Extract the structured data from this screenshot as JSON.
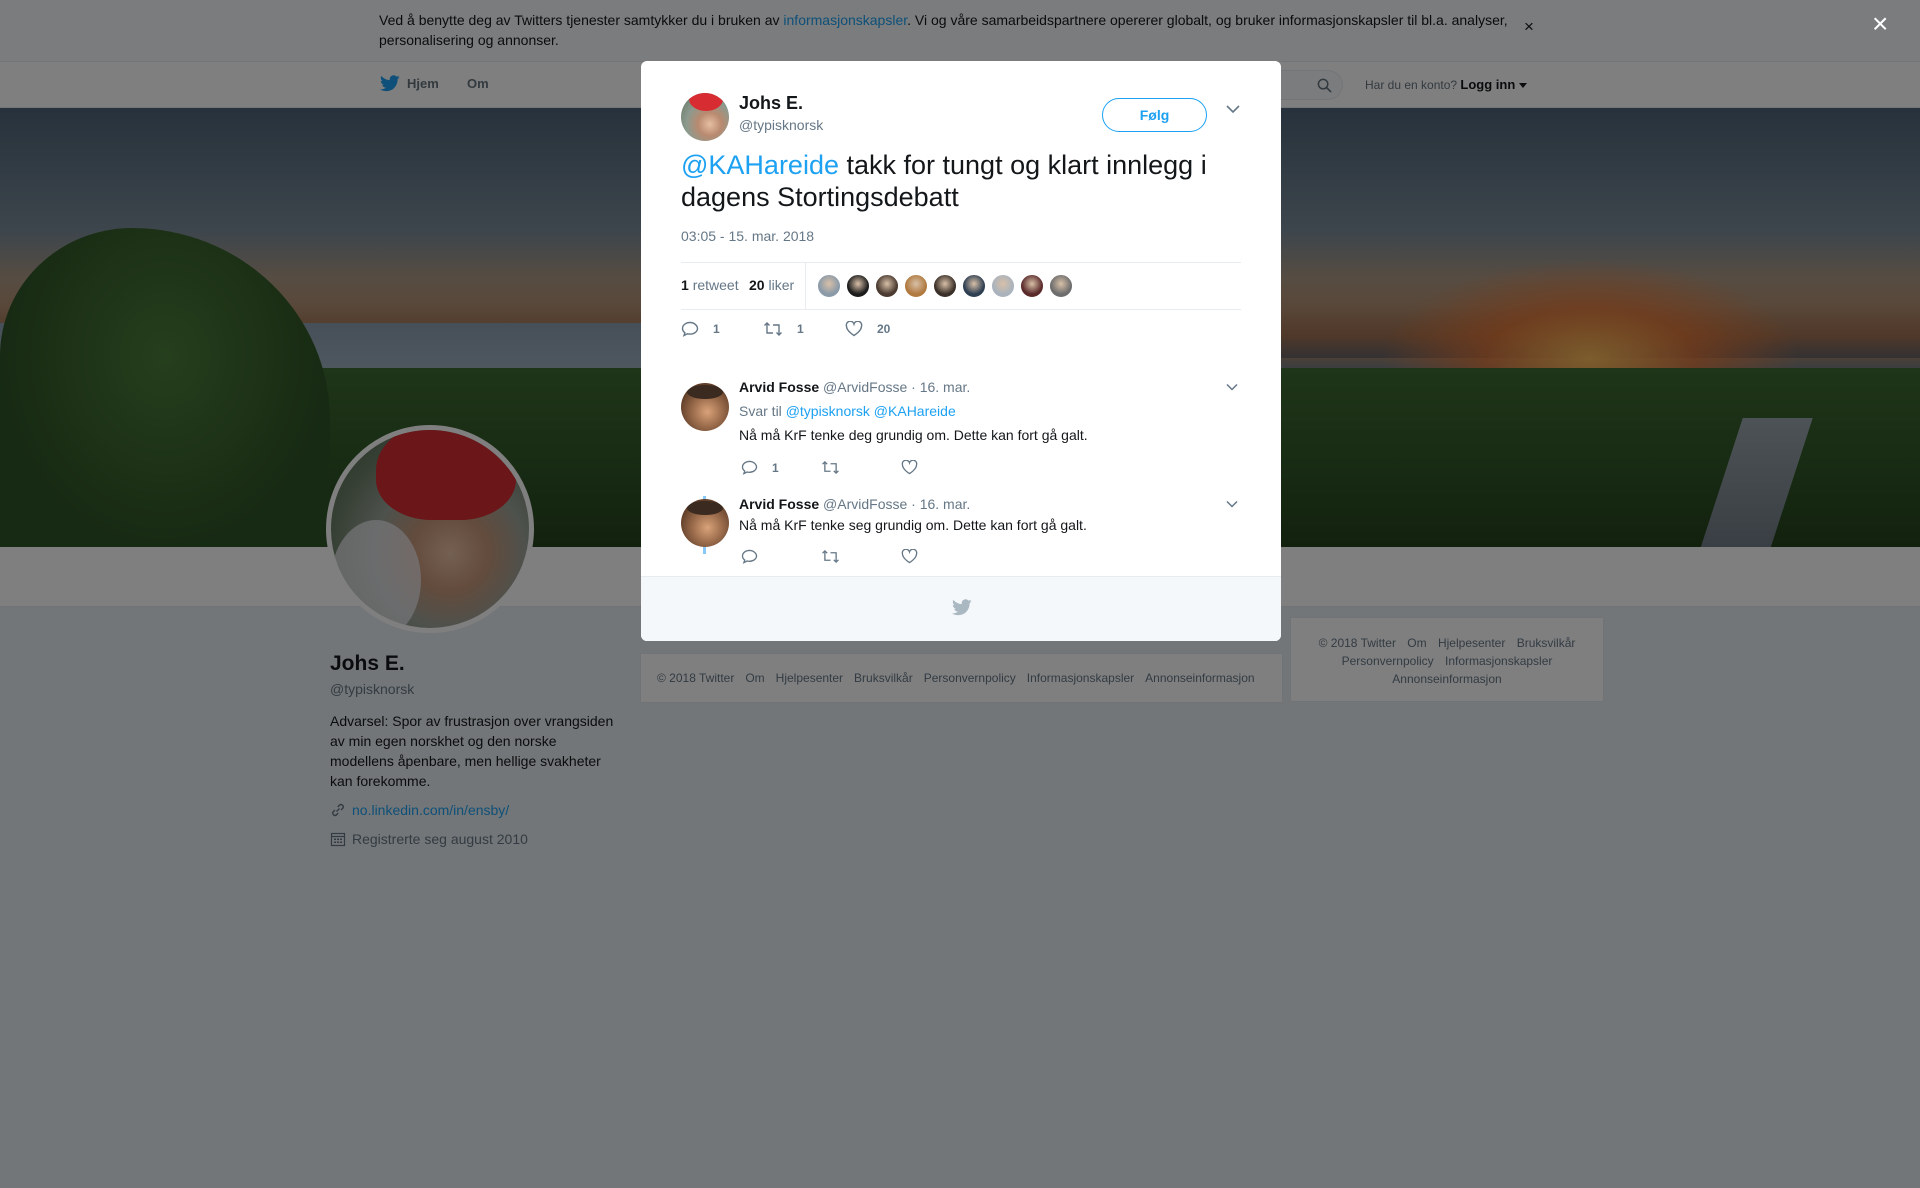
{
  "cookie": {
    "text_before": "Ved å benytte deg av Twitters tjenester samtykker du i bruken av ",
    "link": "informasjonskapsler",
    "text_after": ". Vi og våre samarbeidspartnere opererer globalt, og bruker informasjonskapsler til bl.a. analyser, personalisering og annonser.",
    "close": "×"
  },
  "nav": {
    "home": "Hjem",
    "about": "Om",
    "login_prompt": "Har du en konto?",
    "login": "Logg inn"
  },
  "profile": {
    "name": "Johs E.",
    "handle": "@typisknorsk",
    "bio": "Advarsel: Spor av frustrasjon over vrangsiden av min egen norskhet og den norske modellens åpenbare, men hellige svakheter kan forekomme.",
    "url": "no.linkedin.com/in/ensby/",
    "joined": "Registrerte seg august 2010"
  },
  "footer": {
    "items": [
      "© 2018 Twitter",
      "Om",
      "Hjelpesenter",
      "Bruksvilkår",
      "Personvernpolicy",
      "Informasjonskapsler",
      "Annonseinformasjon"
    ]
  },
  "overlay": {
    "close": "×"
  },
  "tweet": {
    "author_name": "Johs E.",
    "author_handle": "@typisknorsk",
    "follow_label": "Følg",
    "mention": "@KAHareide",
    "text": " takk for tungt og klart innlegg i dagens Stortingsdebatt",
    "timestamp": "03:05 - 15. mar. 2018",
    "retweet_count": "1",
    "retweet_label": "retweet",
    "like_count": "20",
    "like_label": "liker",
    "reply_action_count": "1",
    "retweet_action_count": "1",
    "like_action_count": "20",
    "liker_colors": [
      "#8a9aa8",
      "#1c1c1c",
      "#4a3a30",
      "#b07a40",
      "#3b3029",
      "#2e3f52",
      "#aab3bd",
      "#5a2a2a",
      "#6d6d6d"
    ]
  },
  "replies": [
    {
      "name": "Arvid Fosse",
      "handle": "@ArvidFosse",
      "date": "· 16. mar.",
      "context_label": "Svar til",
      "context_mentions": "@typisknorsk @KAHareide",
      "text": "Nå må KrF tenke deg grundig om. Dette kan fort gå galt.",
      "reply_count": "1"
    },
    {
      "name": "Arvid Fosse",
      "handle": "@ArvidFosse",
      "date": "· 16. mar.",
      "text": "Nå må KrF tenke seg grundig om. Dette kan fort gå galt."
    }
  ]
}
